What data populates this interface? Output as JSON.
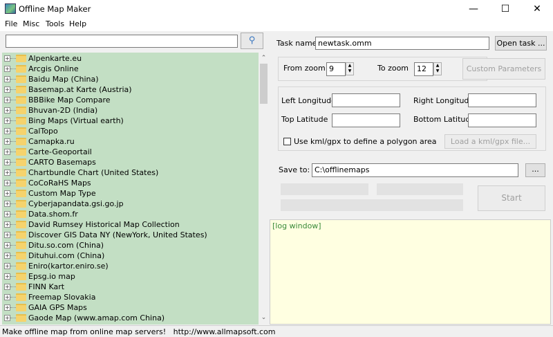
{
  "window": {
    "title": "Offline Map Maker",
    "minimize": "—",
    "maximize": "☐",
    "close": "✕"
  },
  "menu": [
    "File",
    "Misc",
    "Tools",
    "Help"
  ],
  "search": {
    "value": "",
    "icon": "search-icon"
  },
  "tree": {
    "items": [
      "Alpenkarte.eu",
      "Arcgis Online",
      "Baidu Map (China)",
      "Basemap.at Karte (Austria)",
      "BBBike Map Compare",
      "Bhuvan-2D (India)",
      "Bing Maps (Virtual earth)",
      "CalTopo",
      "Camapka.ru",
      "Carte-Geoportail",
      "CARTO Basemaps",
      "Chartbundle Chart (United States)",
      "CoCoRaHS Maps",
      "Custom Map Type",
      "Cyberjapandata.gsi.go.jp",
      "Data.shom.fr",
      "David Rumsey Historical Map Collection",
      "Discover GIS Data NY (NewYork, United States)",
      "Ditu.so.com (China)",
      "Dituhui.com (China)",
      "Eniro(kartor.eniro.se)",
      "Epsg.io map",
      "FINN Kart",
      "Freemap Slovakia",
      "GAIA GPS Maps",
      "Gaode Map (www.amap.com China)"
    ]
  },
  "task": {
    "label": "Task name",
    "value": "newtask.omm",
    "open_button": "Open task ..."
  },
  "zoom": {
    "from_label": "From zoom",
    "from_value": "9",
    "to_label": "To zoom",
    "to_value": "12",
    "custom_button": "Custom Parameters"
  },
  "area": {
    "left_lon_label": "Left Longitude",
    "left_lon": "",
    "right_lon_label": "Right Longitude",
    "right_lon": "",
    "top_lat_label": "Top Latitude",
    "top_lat": "",
    "bottom_lat_label": "Bottom Latitude",
    "bottom_lat": "",
    "kml_checkbox_label": "Use kml/gpx to define a polygon area",
    "kml_checked": false,
    "load_kml_button": "Load a kml/gpx file..."
  },
  "save": {
    "label": "Save to:",
    "value": "C:\\offlinemaps",
    "browse_button": "..."
  },
  "start_button": "Start",
  "log": {
    "text": "[log window]"
  },
  "status": {
    "text": "Make offline map from online map servers!   http://www.allmapsoft.com"
  },
  "colors": {
    "tree_bg": "#c3dfc4",
    "log_bg": "#ffffe1"
  }
}
